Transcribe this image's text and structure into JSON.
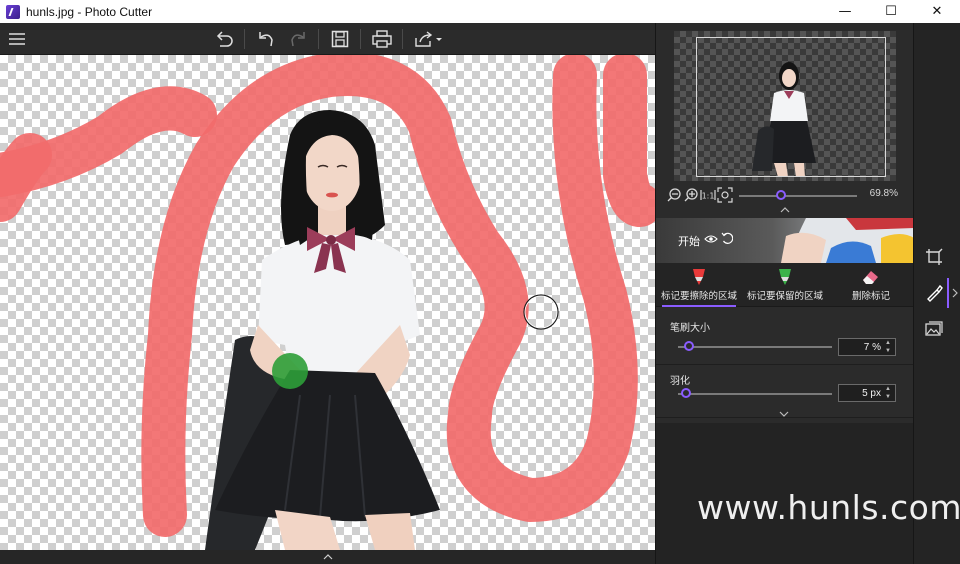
{
  "window": {
    "title": "hunls.jpg - Photo Cutter",
    "controls": {
      "minimize": "—",
      "maximize": "☐",
      "close": "✕"
    }
  },
  "toolbar": {
    "icons": [
      "menu-icon",
      "undo-all-icon",
      "undo-icon",
      "redo-icon",
      "save-icon",
      "print-icon",
      "share-icon"
    ]
  },
  "preview": {
    "zoom_percent": "69.8%",
    "zoom_level": 0.36
  },
  "start_banner": {
    "label": "开始"
  },
  "tools": [
    {
      "label": "标记要擦除的区域",
      "color": "#e83a3a",
      "active": true
    },
    {
      "label": "标记要保留的区域",
      "color": "#3bb34a",
      "active": false
    },
    {
      "label": "删除标记",
      "color": "#e86a8a",
      "active": false
    }
  ],
  "brush": {
    "label": "笔刷大小",
    "value": "7 %",
    "level": 0.07
  },
  "feather": {
    "label": "羽化",
    "value": "5 px",
    "level": 0.05
  },
  "watermark": "www.hunls.com",
  "colors": {
    "accent": "#8a5cff",
    "erase_mark": "#f26b6b",
    "keep_mark": "#2e9e38",
    "panel_bg": "#2b2b2b"
  }
}
